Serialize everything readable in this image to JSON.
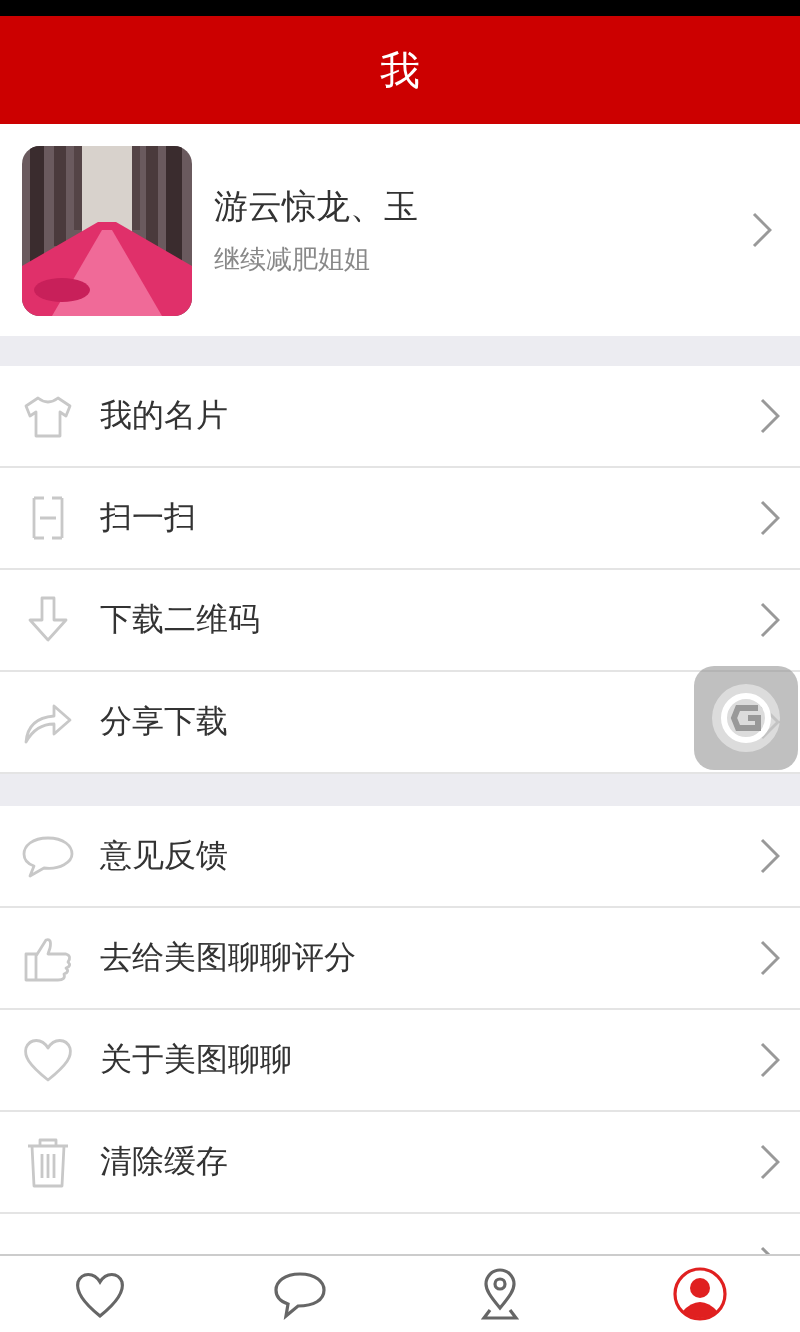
{
  "header": {
    "title": "我"
  },
  "profile": {
    "name": "游云惊龙、玉",
    "subtitle": "继续减肥姐姐"
  },
  "groups": [
    {
      "items": [
        {
          "label": "我的名片"
        },
        {
          "label": "扫一扫"
        },
        {
          "label": "下载二维码"
        },
        {
          "label": "分享下载"
        }
      ]
    },
    {
      "items": [
        {
          "label": "意见反馈"
        },
        {
          "label": "去给美图聊聊评分"
        },
        {
          "label": "关于美图聊聊"
        },
        {
          "label": "清除缓存"
        }
      ]
    }
  ],
  "tabs": [
    {
      "selected": false
    },
    {
      "selected": false
    },
    {
      "selected": false
    },
    {
      "selected": true
    }
  ]
}
